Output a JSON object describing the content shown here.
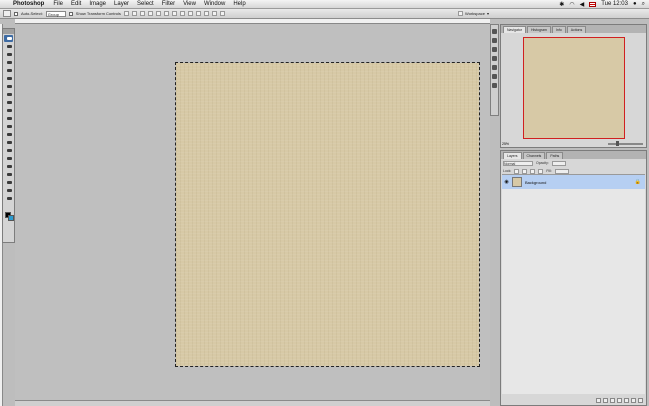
{
  "menubar": {
    "app_name": "Photoshop",
    "menus": [
      "File",
      "Edit",
      "Image",
      "Layer",
      "Select",
      "Filter",
      "View",
      "Window",
      "Help"
    ],
    "time": "Tue 12:03"
  },
  "options_bar": {
    "auto_select_label": "Auto-Select:",
    "group_value": "Group",
    "transform_label": "Show Transform Controls",
    "workspace_label": "Workspace"
  },
  "navigator": {
    "tabs": [
      "Navigator",
      "Histogram",
      "Info",
      "Actions"
    ],
    "zoom": "25%"
  },
  "layers": {
    "tabs": [
      "Layers",
      "Channels",
      "Paths"
    ],
    "blend_mode": "Normal",
    "opacity_label": "Opacity:",
    "lock_label": "Lock:",
    "fill_label": "Fill:",
    "layer_name": "Background"
  },
  "colors": {
    "canvas": "#d7c9a6",
    "selected_layer": "#b6cff2",
    "foreground": "#000000",
    "background_swatch": "#2a9bd0"
  }
}
